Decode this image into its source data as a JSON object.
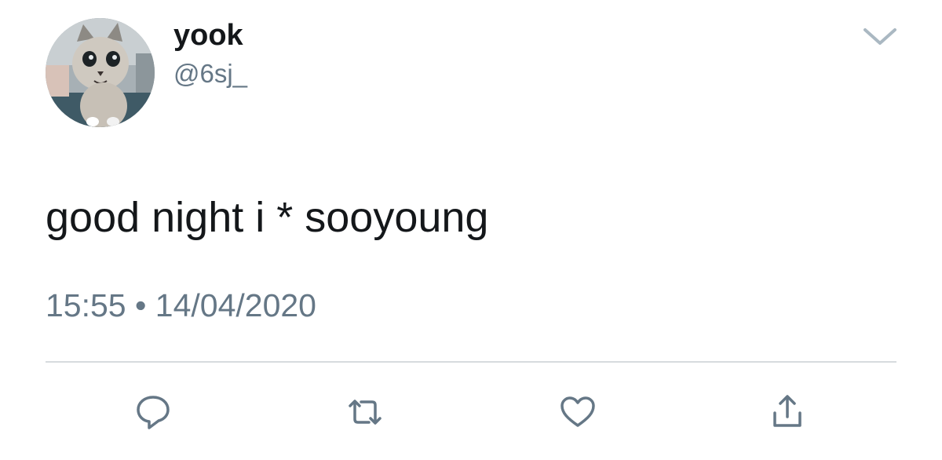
{
  "tweet": {
    "author": {
      "display_name": "yook",
      "handle": "@6sj_",
      "avatar_icon": "cat-avatar"
    },
    "text": "good night i * sooyoung",
    "time": "15:55",
    "separator": "•",
    "date": "14/04/2020"
  },
  "menu": {
    "icon": "chevron-down-icon"
  },
  "actions": [
    {
      "name": "reply",
      "icon": "speech-bubble-icon"
    },
    {
      "name": "retweet",
      "icon": "retweet-icon"
    },
    {
      "name": "like",
      "icon": "heart-icon"
    },
    {
      "name": "share",
      "icon": "share-icon"
    }
  ],
  "colors": {
    "text_primary": "#14171a",
    "text_secondary": "#657786",
    "divider": "#d7dbde",
    "icon": "#657786"
  }
}
